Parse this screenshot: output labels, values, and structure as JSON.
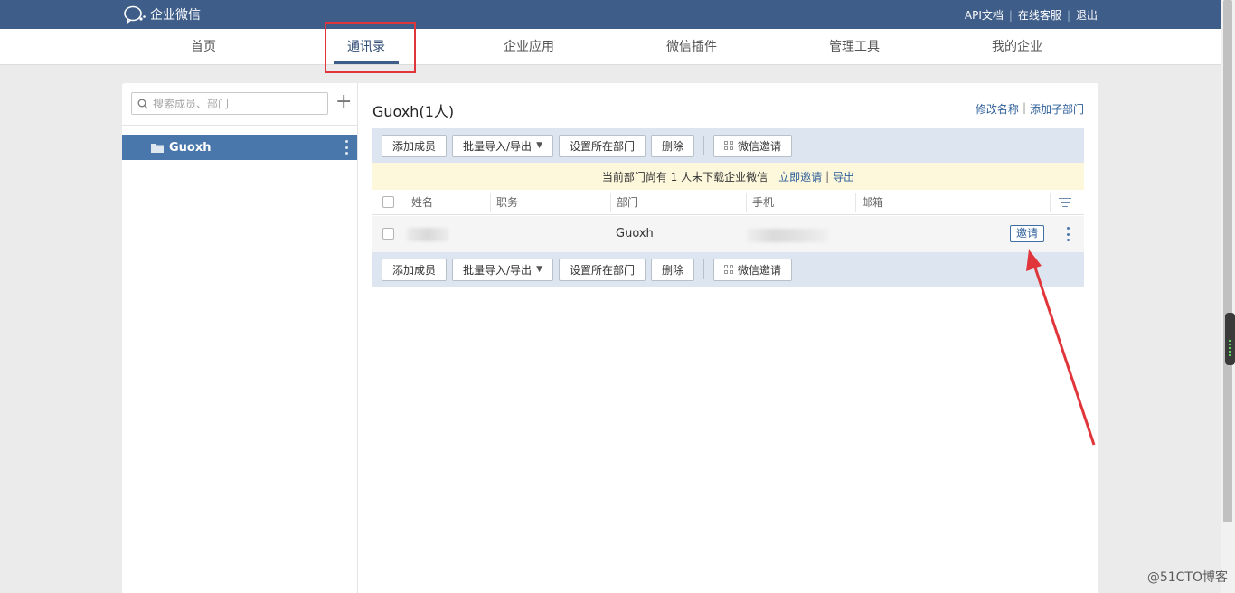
{
  "topbar": {
    "logo_text": "企业微信",
    "links": [
      "API文档",
      "在线客服",
      "退出"
    ],
    "separator": "|",
    "background": "#3e5d88"
  },
  "nav": {
    "items": [
      "首页",
      "通讯录",
      "企业应用",
      "微信插件",
      "管理工具",
      "我的企业"
    ],
    "active_index": 1
  },
  "sidebar": {
    "search_placeholder": "搜索成员、部门",
    "add_icon": "+",
    "departments": [
      {
        "name": "Guoxh",
        "selected": true
      }
    ]
  },
  "content": {
    "department_title": "Guoxh(1人)",
    "actions": [
      "修改名称",
      "添加子部门"
    ],
    "action_separator": "|",
    "toolbar": {
      "add_member": "添加成员",
      "batch_import_export": "批量导入/导出",
      "set_department": "设置所在部门",
      "delete": "删除",
      "wechat_invite": "微信邀请"
    },
    "notice": {
      "text": "当前部门尚有 1 人未下载企业微信",
      "invite_now": "立即邀请",
      "separator": "|",
      "export": "导出"
    },
    "table": {
      "columns": [
        "姓名",
        "职务",
        "部门",
        "手机",
        "邮箱"
      ],
      "rows": [
        {
          "name": "",
          "title": "",
          "department": "Guoxh",
          "phone": "",
          "email": "",
          "action": "邀请"
        }
      ]
    }
  },
  "annotation": {
    "highlight_color": "#e0353b"
  },
  "watermark": "@51CTO博客"
}
